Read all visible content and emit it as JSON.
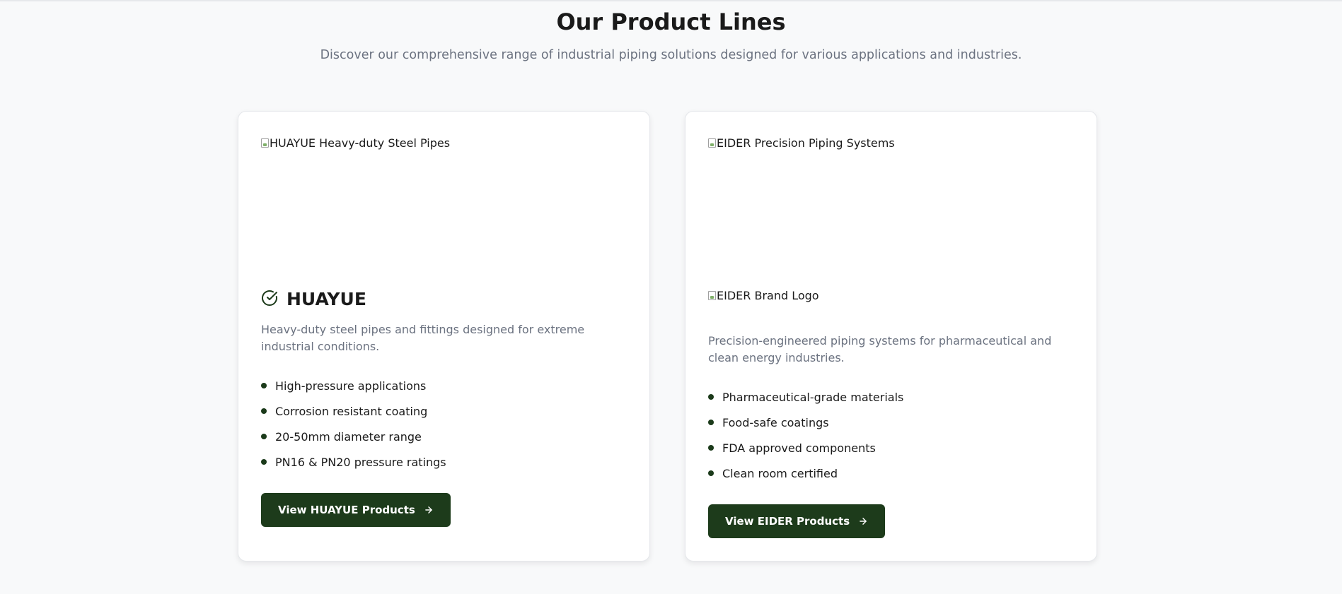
{
  "section": {
    "title": "Our Product Lines",
    "subtitle": "Discover our comprehensive range of industrial piping solutions designed for various applications and industries."
  },
  "cards": [
    {
      "image_alt": "HUAYUE Heavy-duty Steel Pipes",
      "brand": "HUAYUE",
      "brand_icon": "check-circle-icon",
      "description": "Heavy-duty steel pipes and fittings designed for extreme industrial conditions.",
      "features": [
        "High-pressure applications",
        "Corrosion resistant coating",
        "20-50mm diameter range",
        "PN16 & PN20 pressure ratings"
      ],
      "cta_label": "View HUAYUE Products"
    },
    {
      "image_alt": "EIDER Precision Piping Systems",
      "logo_alt": "EIDER Brand Logo",
      "description": "Precision-engineered piping systems for pharmaceutical and clean energy industries.",
      "features": [
        "Pharmaceutical-grade materials",
        "Food-safe coatings",
        "FDA approved components",
        "Clean room certified"
      ],
      "cta_label": "View EIDER Products"
    }
  ],
  "colors": {
    "accent": "#1d3b1b",
    "muted_text": "#6b7280",
    "background": "#f8f9fa"
  }
}
